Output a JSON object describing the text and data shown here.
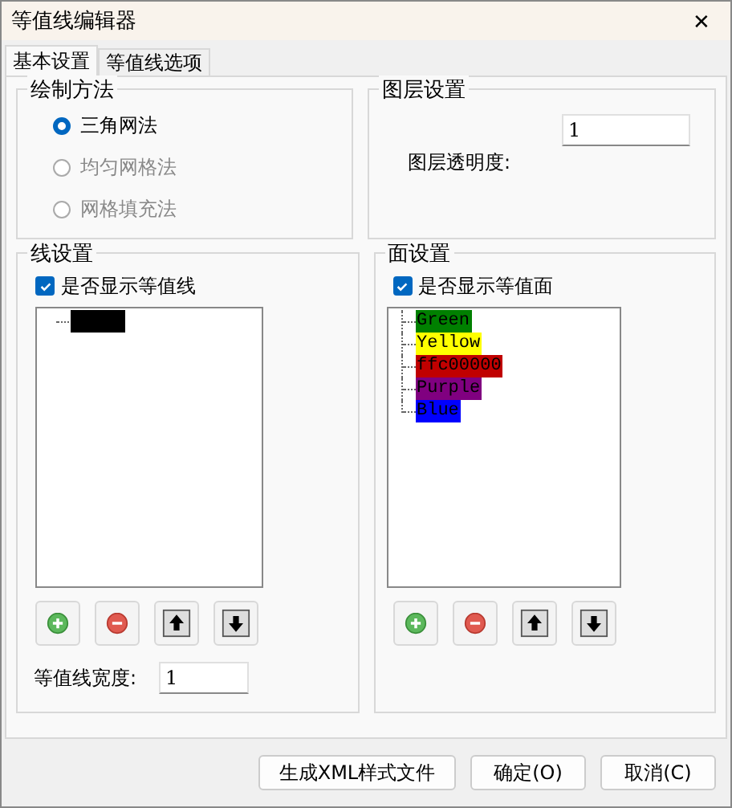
{
  "window": {
    "title": "等值线编辑器",
    "close": "✕"
  },
  "tabs": [
    {
      "label": "基本设置",
      "selected": true
    },
    {
      "label": "等值线选项",
      "selected": false
    }
  ],
  "draw_method": {
    "title": "绘制方法",
    "options": [
      {
        "label": "三角网法",
        "selected": true,
        "disabled": false
      },
      {
        "label": "均匀网格法",
        "selected": false,
        "disabled": true
      },
      {
        "label": "网格填充法",
        "selected": false,
        "disabled": true
      }
    ]
  },
  "layer": {
    "title": "图层设置",
    "opacity_label": "图层透明度:",
    "opacity_value": "1"
  },
  "line": {
    "title": "线设置",
    "show_label": "是否显示等值线",
    "checked": true,
    "items": [
      {
        "color": "#000000"
      }
    ],
    "width_label": "等值线宽度:",
    "width_value": "1"
  },
  "face": {
    "title": "面设置",
    "show_label": "是否显示等值面",
    "checked": true,
    "items": [
      {
        "label": "Green",
        "color": "#008000"
      },
      {
        "label": "Yellow",
        "color": "#ffff00"
      },
      {
        "label": "ffc00000",
        "color": "#c00000"
      },
      {
        "label": "Purple",
        "color": "#800080"
      },
      {
        "label": "Blue",
        "color": "#0000ff"
      }
    ]
  },
  "buttons": [
    {
      "label": "生成XML样式文件"
    },
    {
      "label": "确定(O)"
    },
    {
      "label": "取消(C)"
    }
  ]
}
